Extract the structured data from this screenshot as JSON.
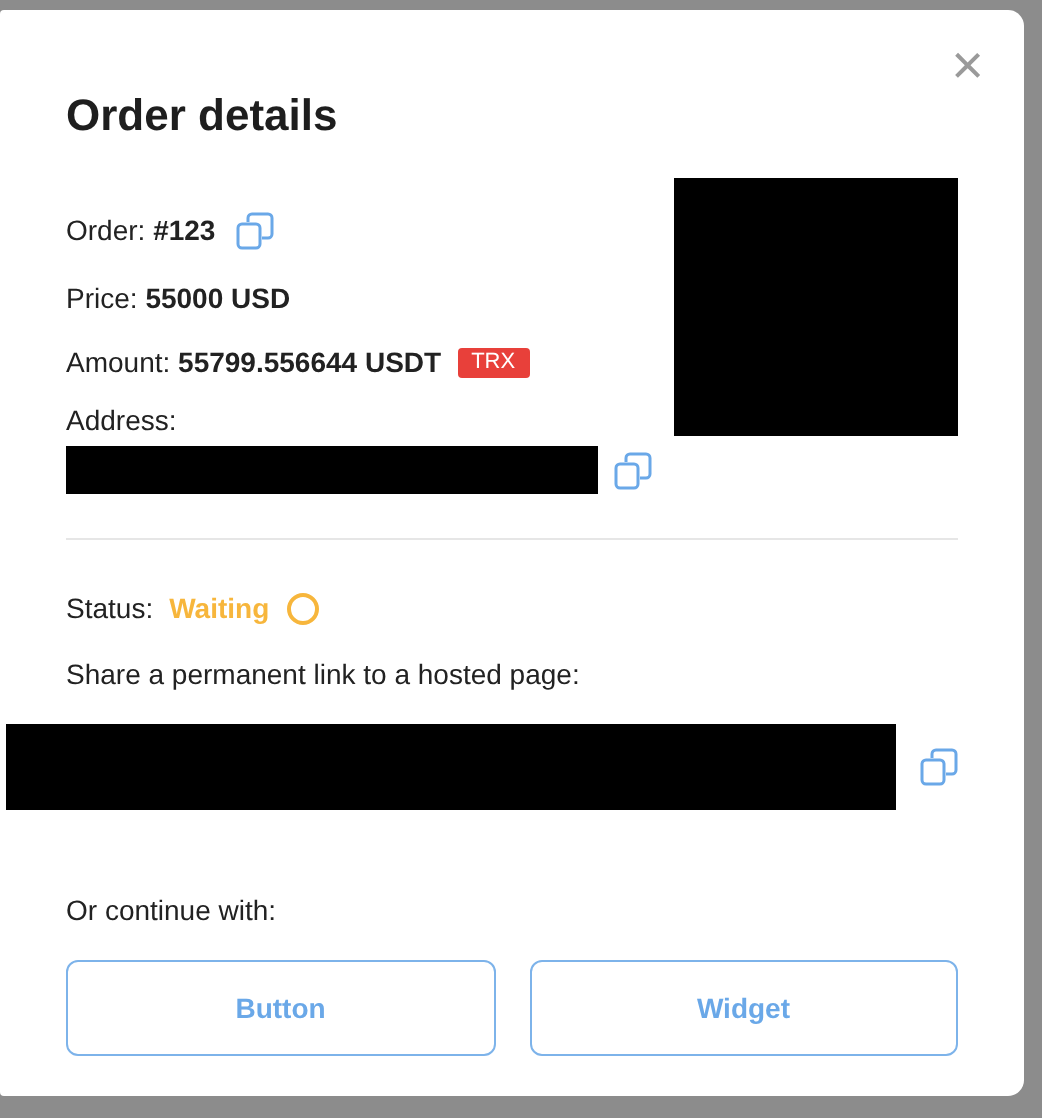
{
  "dialog": {
    "title": "Order details",
    "close": "×"
  },
  "order": {
    "label": "Order:",
    "value": "#123"
  },
  "price": {
    "label": "Price:",
    "value": "55000 USD"
  },
  "amount": {
    "label": "Amount:",
    "value": "55799.556644 USDT",
    "badge": "TRX"
  },
  "address": {
    "label": "Address:"
  },
  "status": {
    "label": "Status:",
    "value": "Waiting",
    "kind": "waiting"
  },
  "share": {
    "label": "Share a permanent link to a hosted page:"
  },
  "continue": {
    "label": "Or continue with:",
    "buttons": [
      "Button",
      "Widget"
    ]
  }
}
